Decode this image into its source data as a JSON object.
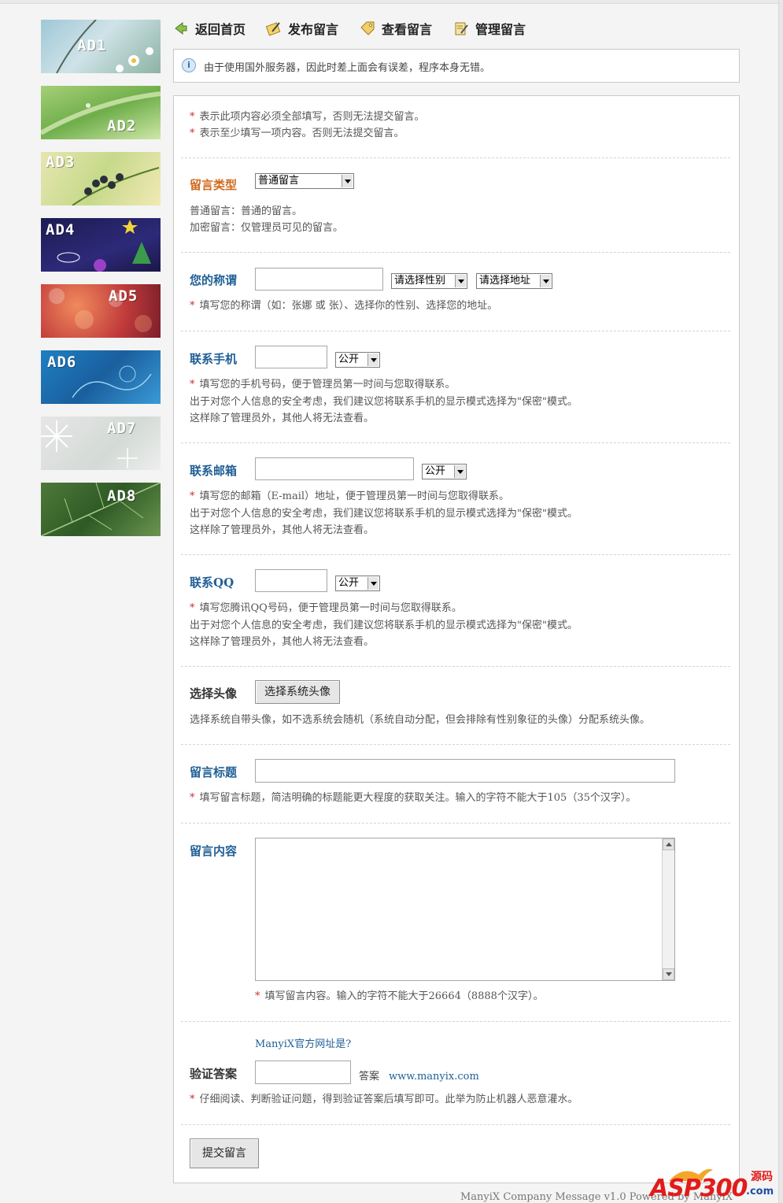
{
  "ads": [
    {
      "label": "AD1"
    },
    {
      "label": "AD2"
    },
    {
      "label": "AD3"
    },
    {
      "label": "AD4"
    },
    {
      "label": "AD5"
    },
    {
      "label": "AD6"
    },
    {
      "label": "AD7"
    },
    {
      "label": "AD8"
    }
  ],
  "nav": {
    "home": "返回首页",
    "post": "发布留言",
    "view": "查看留言",
    "manage": "管理留言"
  },
  "notice": "由于使用国外服务器，因此时差上面会有误差，程序本身无错。",
  "legend": {
    "required": "表示此项内容必须全部填写，否则无法提交留言。",
    "at_least_one": "表示至少填写一项内容。否则无法提交留言。"
  },
  "type": {
    "label": "留言类型",
    "selected": "普通留言",
    "hint1": "普通留言：普通的留言。",
    "hint2": "加密留言：仅管理员可见的留言。"
  },
  "nickname": {
    "label": "您的称谓",
    "gender": "请选择性别",
    "address": "请选择地址",
    "hint": "填写您的称谓（如：张娜 或 张）、选择你的性别、选择您的地址。"
  },
  "mobile": {
    "label": "联系手机",
    "visibility": "公开",
    "hint1": "填写您的手机号码，便于管理员第一时间与您取得联系。",
    "hint2": "出于对您个人信息的安全考虑，我们建议您将联系手机的显示模式选择为\"保密\"模式。",
    "hint3": "这样除了管理员外，其他人将无法查看。"
  },
  "email": {
    "label": "联系邮箱",
    "visibility": "公开",
    "hint1": "填写您的邮箱（E-mail）地址，便于管理员第一时间与您取得联系。",
    "hint2": "出于对您个人信息的安全考虑，我们建议您将联系手机的显示模式选择为\"保密\"模式。",
    "hint3": "这样除了管理员外，其他人将无法查看。"
  },
  "qq": {
    "label": "联系QQ",
    "visibility": "公开",
    "hint1": "填写您腾讯QQ号码，便于管理员第一时间与您取得联系。",
    "hint2": "出于对您个人信息的安全考虑，我们建议您将联系手机的显示模式选择为\"保密\"模式。",
    "hint3": "这样除了管理员外，其他人将无法查看。"
  },
  "avatar": {
    "label": "选择头像",
    "button": "选择系统头像",
    "hint": "选择系统自带头像，如不选系统会随机（系统自动分配，但会排除有性别象征的头像）分配系统头像。"
  },
  "title": {
    "label": "留言标题",
    "hint": "填写留言标题，简洁明确的标题能更大程度的获取关注。输入的字符不能大于105（35个汉字）。"
  },
  "content": {
    "label": "留言内容",
    "hint": "填写留言内容。输入的字符不能大于26664（8888个汉字）。"
  },
  "verify": {
    "question": "ManyiX官方网址是?",
    "label": "验证答案",
    "answer_label": "答案",
    "answer": "www.manyix.com",
    "hint": "仔细阅读、判断验证问题，得到验证答案后填写即可。此举为防止机器人恶意灌水。"
  },
  "submit": "提交留言",
  "footer": "ManyiX Company Message v1.0 Powered by ManyiX",
  "watermark": {
    "text": "ASP300",
    "sub": "源码",
    "com": ".com"
  }
}
